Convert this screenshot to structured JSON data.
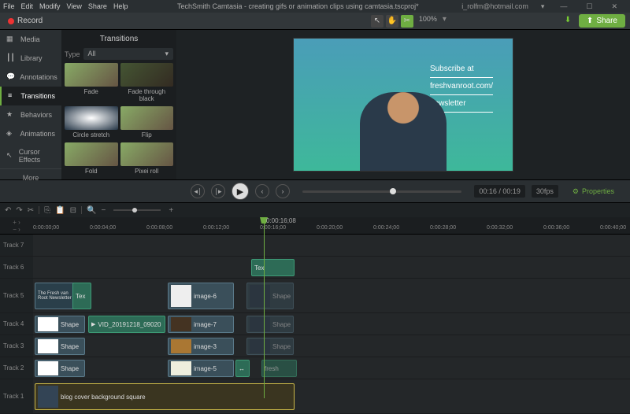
{
  "menu": {
    "items": [
      "File",
      "Edit",
      "Modify",
      "View",
      "Share",
      "Help"
    ]
  },
  "title": "TechSmith Camtasia - creating gifs or animation clips using camtasia.tscproj*",
  "user": "i_rolfm@hotmail.com",
  "toolbar": {
    "record": "Record",
    "zoom": "100%",
    "share": "Share"
  },
  "sidebar": {
    "items": [
      {
        "icon": "media",
        "label": "Media"
      },
      {
        "icon": "library",
        "label": "Library"
      },
      {
        "icon": "annot",
        "label": "Annotations"
      },
      {
        "icon": "trans",
        "label": "Transitions"
      },
      {
        "icon": "behav",
        "label": "Behaviors"
      },
      {
        "icon": "anim",
        "label": "Animations"
      },
      {
        "icon": "cursor",
        "label": "Cursor Effects"
      }
    ],
    "more": "More"
  },
  "library": {
    "title": "Transitions",
    "type_label": "Type",
    "type_value": "All",
    "items": [
      "Fade",
      "Fade through black",
      "Circle stretch",
      "Flip",
      "Fold",
      "Pixei roll"
    ]
  },
  "canvas": {
    "line1": "Subscribe at",
    "line2": "freshvanroot.com/",
    "line3": "newsletter"
  },
  "playback": {
    "time": "00:16 / 00:19",
    "fps": "30fps",
    "properties": "Properties"
  },
  "timeline": {
    "playhead_time": "0:00:16;08",
    "ticks": [
      "0:00:00;00",
      "0:00:04;00",
      "0:00:08;00",
      "0:00:12;00",
      "0:00:16;00",
      "0:00:20;00",
      "0:00:24;00",
      "0:00:28;00",
      "0:00:32;00",
      "0:00:36;00",
      "0:00:40;00"
    ],
    "tracks": [
      "Track 7",
      "Track 6",
      "Track 5",
      "Track 4",
      "Track 3",
      "Track 2",
      "Track 1"
    ],
    "clips": {
      "t6_tex": "Tex",
      "t5_box": "The Fresh van Root Newsletter",
      "t5_tex": "Tex",
      "t5_img": "image-6",
      "t5_shape": "Shape",
      "t4_shape": "Shape",
      "t4_vid": "VID_20191218_09020",
      "t4_img": "image-7",
      "t4_shape2": "Shape",
      "t3_shape": "Shape",
      "t3_img": "image-3",
      "t3_shape2": "Shape",
      "t2_shape": "Shape",
      "t2_img": "image-5",
      "t2_fresh": "fresh",
      "t1_bg": "blog cover background square"
    }
  }
}
